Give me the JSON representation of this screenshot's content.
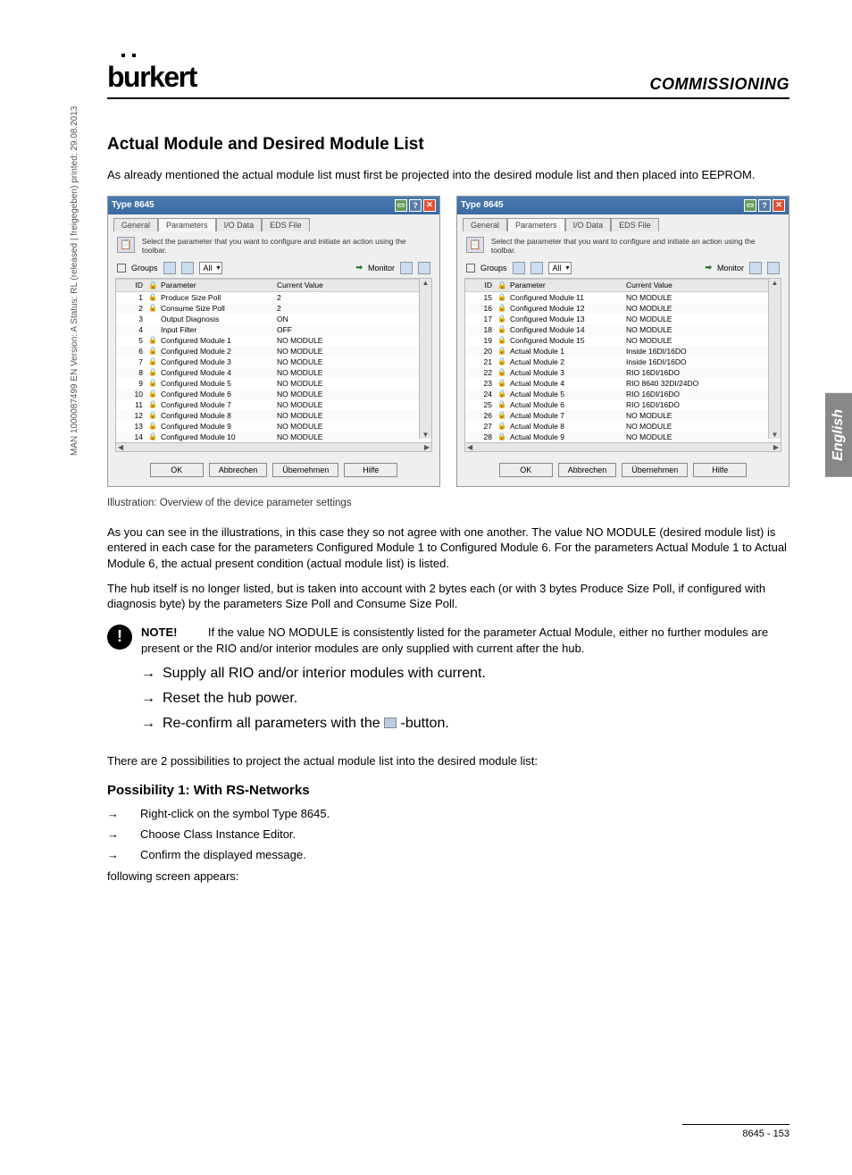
{
  "brand": "burkert",
  "section": "COMMISSIONING",
  "sidetext": "MAN 1000087499 EN Version: A  Status: RL (released | freigegeben)  printed: 29.08.2013",
  "lang_tab": "English",
  "title": "Actual Module and Desired Module List",
  "intro": "As already mentioned the actual module list must first be projected into the desired module list and then placed into EEPROM.",
  "win_title": "Type 8645",
  "tabs": {
    "general": "General",
    "params": "Parameters",
    "io": "I/O Data",
    "eds": "EDS File"
  },
  "hint": "Select the parameter that you want to configure and initiate an action using the toolbar.",
  "groups_label": "Groups",
  "all_label": "All",
  "monitor_label": "Monitor",
  "grid_head": {
    "id": "ID",
    "param": "Parameter",
    "val": "Current Value"
  },
  "left_rows": [
    {
      "id": "1",
      "lock": "🔒",
      "p": "Produce Size Poll",
      "v": "2"
    },
    {
      "id": "2",
      "lock": "🔒",
      "p": "Consume Size Poll",
      "v": "2"
    },
    {
      "id": "3",
      "lock": "",
      "p": "Output Diagnosis",
      "v": "ON"
    },
    {
      "id": "4",
      "lock": "",
      "p": "Input Filter",
      "v": "OFF"
    },
    {
      "id": "5",
      "lock": "🔒",
      "p": "Configured Module 1",
      "v": "NO MODULE"
    },
    {
      "id": "6",
      "lock": "🔒",
      "p": "Configured Module 2",
      "v": "NO MODULE"
    },
    {
      "id": "7",
      "lock": "🔒",
      "p": "Configured Module 3",
      "v": "NO MODULE"
    },
    {
      "id": "8",
      "lock": "🔒",
      "p": "Configured Module 4",
      "v": "NO MODULE"
    },
    {
      "id": "9",
      "lock": "🔒",
      "p": "Configured Module 5",
      "v": "NO MODULE"
    },
    {
      "id": "10",
      "lock": "🔒",
      "p": "Configured Module 6",
      "v": "NO MODULE"
    },
    {
      "id": "11",
      "lock": "🔒",
      "p": "Configured Module 7",
      "v": "NO MODULE"
    },
    {
      "id": "12",
      "lock": "🔒",
      "p": "Configured Module 8",
      "v": "NO MODULE"
    },
    {
      "id": "13",
      "lock": "🔒",
      "p": "Configured Module 9",
      "v": "NO MODULE"
    },
    {
      "id": "14",
      "lock": "🔒",
      "p": "Configured Module 10",
      "v": "NO MODULE"
    }
  ],
  "right_rows": [
    {
      "id": "15",
      "lock": "🔒",
      "p": "Configured Module 11",
      "v": "NO MODULE"
    },
    {
      "id": "16",
      "lock": "🔒",
      "p": "Configured Module 12",
      "v": "NO MODULE"
    },
    {
      "id": "17",
      "lock": "🔒",
      "p": "Configured Module 13",
      "v": "NO MODULE"
    },
    {
      "id": "18",
      "lock": "🔒",
      "p": "Configured Module 14",
      "v": "NO MODULE"
    },
    {
      "id": "19",
      "lock": "🔒",
      "p": "Configured Module 15",
      "v": "NO MODULE"
    },
    {
      "id": "20",
      "lock": "🔒",
      "p": "Actual Module 1",
      "v": "Inside 16DI/16DO"
    },
    {
      "id": "21",
      "lock": "🔒",
      "p": "Actual Module 2",
      "v": "Inside 16DI/16DO"
    },
    {
      "id": "22",
      "lock": "🔒",
      "p": "Actual Module 3",
      "v": "RIO 16DI/16DO"
    },
    {
      "id": "23",
      "lock": "🔒",
      "p": "Actual Module 4",
      "v": "RIO 8640 32DI/24DO"
    },
    {
      "id": "24",
      "lock": "🔒",
      "p": "Actual Module 5",
      "v": "RIO 16DI/16DO"
    },
    {
      "id": "25",
      "lock": "🔒",
      "p": "Actual Module 6",
      "v": "RIO 16DI/16DO"
    },
    {
      "id": "26",
      "lock": "🔒",
      "p": "Actual Module 7",
      "v": "NO MODULE"
    },
    {
      "id": "27",
      "lock": "🔒",
      "p": "Actual Module 8",
      "v": "NO MODULE"
    },
    {
      "id": "28",
      "lock": "🔒",
      "p": "Actual Module 9",
      "v": "NO MODULE"
    }
  ],
  "btns": {
    "ok": "OK",
    "cancel": "Abbrechen",
    "apply": "Übernehmen",
    "help": "Hilfe"
  },
  "caption": "Illustration: Overview of the device parameter settings",
  "body1": "As you can see in the illustrations, in this case they so not agree with one another. The value NO MODULE (desired module list) is entered in each case for the parameters Configured Module 1 to Configured Module 6. For the parameters Actual Module 1 to Actual Module 6, the actual present condition (actual module list) is listed.",
  "body2": "The hub itself is no longer listed, but is taken into account with 2 bytes each (or with 3 bytes Produce Size Poll, if configured with diagnosis byte) by the parameters Size Poll and Consume Size Poll.",
  "note_label": "NOTE!",
  "note_body": "If the value NO MODULE is consistently listed for the parameter Actual Module, either no further modules are present or the RIO and/or interior modules are only supplied with current after the hub.",
  "note_items": {
    "n1": "Supply all RIO and/or interior modules with current.",
    "n2": "Reset the hub power.",
    "n3a": "Re-confirm all parameters with the ",
    "n3b": " -button."
  },
  "body3": "There are 2 possibilities to project the actual module list into the desired module list:",
  "poss1_title": "Possibility 1: With RS-Networks",
  "poss1": {
    "s1": "Right-click on the symbol Type 8645.",
    "s2": "Choose Class Instance Editor.",
    "s3": "Confirm the displayed message."
  },
  "poss1_after": "following screen appears:",
  "footer": "8645  -  153"
}
